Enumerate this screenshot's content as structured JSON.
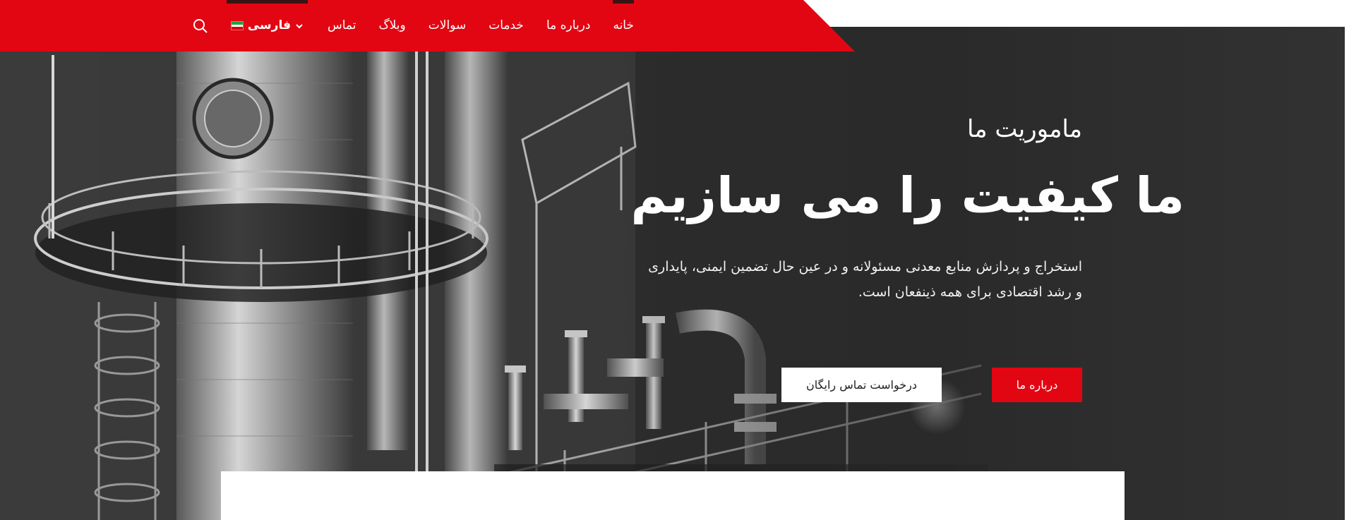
{
  "nav": {
    "items": [
      {
        "label": "خانه",
        "active": true
      },
      {
        "label": "درباره ما",
        "active": false
      },
      {
        "label": "خدمات",
        "active": false
      },
      {
        "label": "سوالات",
        "active": false
      },
      {
        "label": "وبلاگ",
        "active": false
      },
      {
        "label": "تماس",
        "active": false
      }
    ],
    "language": {
      "label": "فارسی",
      "flag_icon": "iran-flag-icon",
      "dropdown_icon": "chevron-down-icon"
    },
    "search_icon": "search-icon"
  },
  "hero": {
    "eyebrow": "ماموریت ما",
    "headline": "ما کیفیت را می سازیم",
    "description_line1": "استخراج و پردازش منابع معدنی مسئولانه و در عین حال تضمین ایمنی، پایداری",
    "description_line2": "و رشد اقتصادی برای همه ذینفعان است.",
    "primary_button": "درباره ما",
    "secondary_button": "درخواست تماس رایگان"
  },
  "colors": {
    "brand_red": "#e20613",
    "hero_bg": "#333333",
    "text_light": "#ffffff"
  }
}
